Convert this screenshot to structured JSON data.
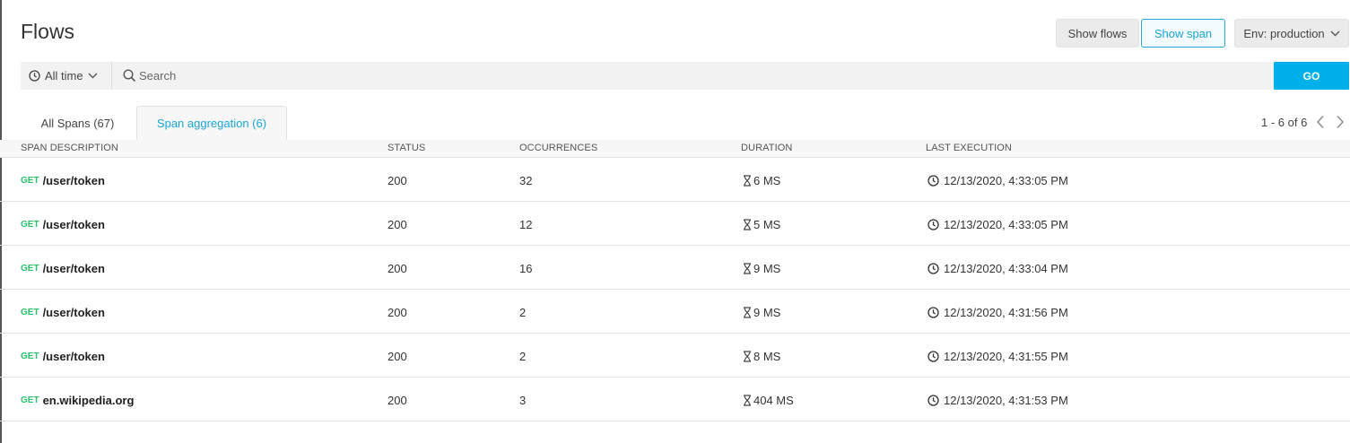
{
  "header": {
    "title": "Flows",
    "show_flows_label": "Show flows",
    "show_span_label": "Show span",
    "env_label": "Env: production"
  },
  "search": {
    "time_filter": "All time",
    "placeholder": "Search",
    "value": "",
    "go_label": "GO"
  },
  "tabs": [
    {
      "label": "All Spans (67)",
      "active": false
    },
    {
      "label": "Span aggregation (6)",
      "active": true
    }
  ],
  "pagination": {
    "text": "1 - 6 of 6"
  },
  "table": {
    "columns": [
      "SPAN DESCRIPTION",
      "STATUS",
      "OCCURRENCES",
      "DURATION",
      "LAST EXECUTION"
    ],
    "rows": [
      {
        "method": "GET",
        "description": "/user/token",
        "status": "200",
        "occurrences": "32",
        "duration": "6 MS",
        "last_execution": "12/13/2020, 4:33:05 PM"
      },
      {
        "method": "GET",
        "description": "/user/token",
        "status": "200",
        "occurrences": "12",
        "duration": "5 MS",
        "last_execution": "12/13/2020, 4:33:05 PM"
      },
      {
        "method": "GET",
        "description": "/user/token",
        "status": "200",
        "occurrences": "16",
        "duration": "9 MS",
        "last_execution": "12/13/2020, 4:33:04 PM"
      },
      {
        "method": "GET",
        "description": "/user/token",
        "status": "200",
        "occurrences": "2",
        "duration": "9 MS",
        "last_execution": "12/13/2020, 4:31:56 PM"
      },
      {
        "method": "GET",
        "description": "/user/token",
        "status": "200",
        "occurrences": "2",
        "duration": "8 MS",
        "last_execution": "12/13/2020, 4:31:55 PM"
      },
      {
        "method": "GET",
        "description": "en.wikipedia.org",
        "status": "200",
        "occurrences": "3",
        "duration": "404 MS",
        "last_execution": "12/13/2020, 4:31:53 PM"
      }
    ]
  },
  "icons": {
    "time_filter": "clock-icon",
    "time_chevron": "chevron-down-icon",
    "env_chevron": "chevron-down-icon",
    "search": "search-icon",
    "prev": "chevron-left-icon",
    "next": "chevron-right-icon",
    "duration": "hourglass-icon",
    "last_execution": "clock-icon"
  },
  "colors": {
    "accent": "#00b0ea",
    "method_get": "#27c26a",
    "active_tab_text": "#1aa6d8"
  }
}
